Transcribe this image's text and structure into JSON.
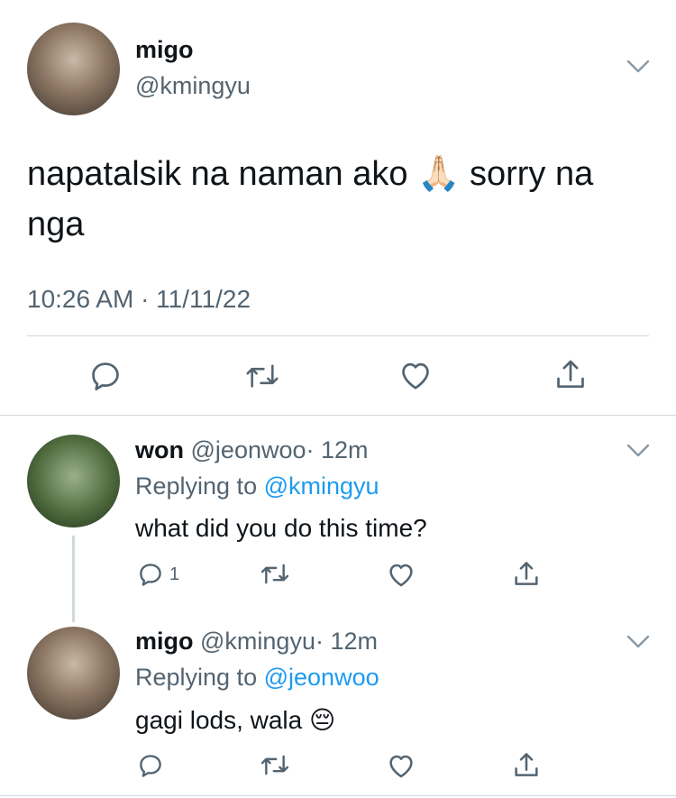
{
  "main_tweet": {
    "display_name": "migo",
    "handle": "@kmingyu",
    "text": "napatalsik na naman ako 🙏🏻 sorry na nga",
    "timestamp": "10:26 AM · 11/11/22"
  },
  "replies": [
    {
      "display_name": "won",
      "handle": "@jeonwoo",
      "time": "· 12m",
      "replying_prefix": "Replying to",
      "replying_to": "@kmingyu",
      "text": "what did you do this time?",
      "reply_count": "1"
    },
    {
      "display_name": "migo",
      "handle": "@kmingyu",
      "time": "· 12m",
      "replying_prefix": "Replying to",
      "replying_to": "@jeonwoo",
      "text": "gagi lods, wala 😔",
      "reply_count": ""
    }
  ],
  "colors": {
    "accent": "#1d9bf0",
    "muted": "#536471",
    "divider": "#cfd9de"
  },
  "icons": [
    "reply-icon",
    "retweet-icon",
    "like-icon",
    "share-icon",
    "chevron-down-icon"
  ]
}
